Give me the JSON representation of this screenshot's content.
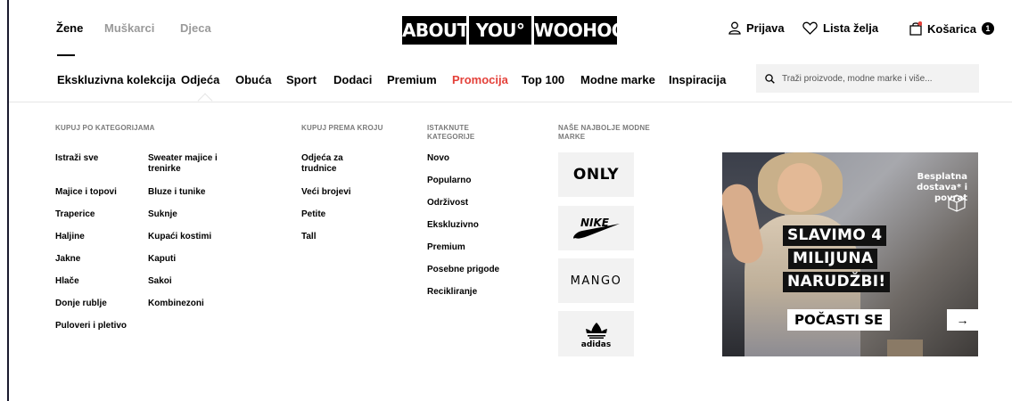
{
  "header": {
    "genders": [
      {
        "label": "Žene",
        "active": true
      },
      {
        "label": "Muškarci",
        "active": false
      },
      {
        "label": "Djeca",
        "active": false
      }
    ],
    "logo": [
      "ABOUT",
      "YOU°",
      "WOOHOO"
    ],
    "login_label": "Prijava",
    "wishlist_label": "Lista želja",
    "cart_label": "Košarica",
    "cart_count": "1"
  },
  "nav": {
    "items": [
      "Ekskluzivna kolekcija",
      "Odjeća",
      "Obuća",
      "Sport",
      "Dodaci",
      "Premium",
      "Promocija",
      "Top 100",
      "Modne marke",
      "Inspiracija"
    ],
    "active_item": "Odjeća",
    "promo_color": "#e4413a",
    "search_placeholder": "Traži proizvode, modne marke i više..."
  },
  "menu": {
    "categories_title": "KUPUJ PO KATEGORIJAMA",
    "categories_col1": [
      "Istraži sve",
      "Majice i topovi",
      "Traperice",
      "Haljine",
      "Jakne",
      "Hlače",
      "Donje rublje",
      "Puloveri i pletivo"
    ],
    "categories_col2": [
      "Sweater majice i trenirke",
      "Bluze i tunike",
      "Suknje",
      "Kupaći kostimi",
      "Kaputi",
      "Sakoi",
      "Kombinezoni"
    ],
    "fit_title": "KUPUJ PREMA KROJU",
    "fit_items": [
      "Odjeća za trudnice",
      "Veći brojevi",
      "Petite",
      "Tall"
    ],
    "highlight_title": "ISTAKNUTE KATEGORIJE",
    "highlight_items": [
      "Novo",
      "Popularno",
      "Održivost",
      "Ekskluzivno",
      "Premium",
      "Posebne prigode",
      "Recikliranje"
    ],
    "brands_title": "NAŠE NAJBOLJE MODNE MARKE",
    "brands": [
      "ONLY",
      "NIKE",
      "MANGO",
      "adidas"
    ]
  },
  "banner": {
    "badge": [
      "Besplatna",
      "dostava* i",
      "povrat"
    ],
    "headline": [
      "SLAVIMO 4",
      "MILIJUNA",
      "NARUDŽBI!"
    ],
    "cta_label": "POČASTI SE",
    "cta_arrow": "→"
  }
}
